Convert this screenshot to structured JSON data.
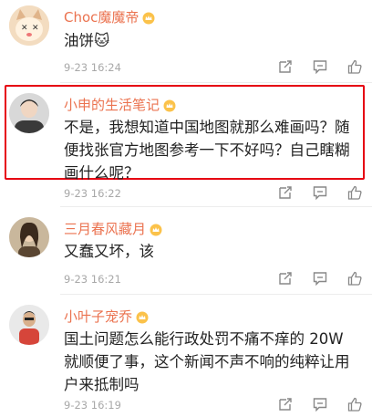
{
  "comments": [
    {
      "username": "Choc魔魔帝",
      "text": "油饼🐱",
      "time": "9-23 16:24",
      "avatar_icon": "cat-face-avatar-icon"
    },
    {
      "username": "小申的生活笔记",
      "text": "不是，我想知道中国地图就那么难画吗？随便找张官方地图参考一下不好吗？自己瞎糊画什么呢？",
      "time": "9-23 16:22",
      "avatar_icon": "person-photo-avatar-icon",
      "highlighted": true
    },
    {
      "username": "三月春风藏月",
      "text": "又蠢又坏，该",
      "time": "9-23 16:21",
      "avatar_icon": "woman-photo-avatar-icon"
    },
    {
      "username": "小叶子宠乔",
      "text": "国土问题怎么能行政处罚不痛不痒的 20W 就顺便了事，这个新闻不声不响的纯粹让用户来抵制吗",
      "time": "9-23 16:19",
      "avatar_icon": "man-red-shirt-avatar-icon"
    }
  ],
  "actions": [
    "share-icon",
    "comment-icon",
    "like-icon"
  ],
  "colors": {
    "username": "#eb7350",
    "highlight_border": "#e60012",
    "time": "#a8a8a8"
  }
}
